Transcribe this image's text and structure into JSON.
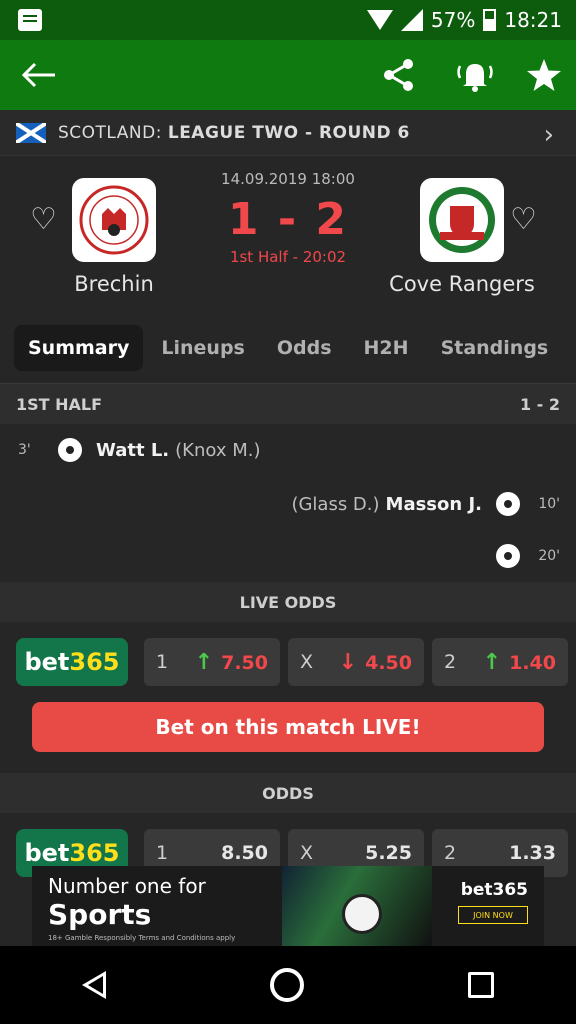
{
  "status_bar": {
    "battery": "57%",
    "time": "18:21"
  },
  "app_bar": {
    "back_icon": "arrow-left-icon",
    "share_icon": "share-icon",
    "alarm_icon": "bell-ringing-icon",
    "star_icon": "star-icon"
  },
  "league": {
    "country": "SCOTLAND:",
    "name": "LEAGUE TWO - ROUND 6"
  },
  "match": {
    "date": "14.09.2019 18:00",
    "score": "1 - 2",
    "status": "1st Half - 20:02",
    "home": {
      "name": "Brechin"
    },
    "away": {
      "name": "Cove Rangers"
    }
  },
  "tabs": [
    "Summary",
    "Lineups",
    "Odds",
    "H2H",
    "Standings"
  ],
  "first_half": {
    "title": "1ST HALF",
    "score": "1 - 2",
    "events": [
      {
        "minute": "3'",
        "scorer": "Watt L.",
        "assist": "(Knox M.)"
      },
      {
        "minute": "10'",
        "scorer": "Masson J.",
        "assist": "(Glass D.)"
      },
      {
        "minute": "20'"
      }
    ]
  },
  "live_odds": {
    "title": "LIVE ODDS",
    "bookmaker_main": "bet",
    "bookmaker_accent": "365",
    "home": {
      "label": "1",
      "value": "7.50"
    },
    "draw": {
      "label": "X",
      "value": "4.50"
    },
    "away": {
      "label": "2",
      "value": "1.40"
    },
    "cta": "Bet on this match LIVE!"
  },
  "odds": {
    "title": "ODDS",
    "bookmaker_main": "bet",
    "bookmaker_accent": "365",
    "home": {
      "label": "1",
      "value": "8.50"
    },
    "draw": {
      "label": "X",
      "value": "5.25"
    },
    "away": {
      "label": "2",
      "value": "1.33"
    }
  },
  "ad": {
    "line1": "Number one for",
    "line2": "Sports",
    "fine_print": "18+  Gamble Responsibly  Terms and Conditions apply",
    "brand": "bet365",
    "join": "JOIN NOW"
  },
  "colors": {
    "app_bar": "#0f7a0f",
    "status_bar": "#0d5c0d",
    "live_red": "#f0484b",
    "bet365_green": "#13754a",
    "bet365_yellow": "#ffdf1b"
  }
}
